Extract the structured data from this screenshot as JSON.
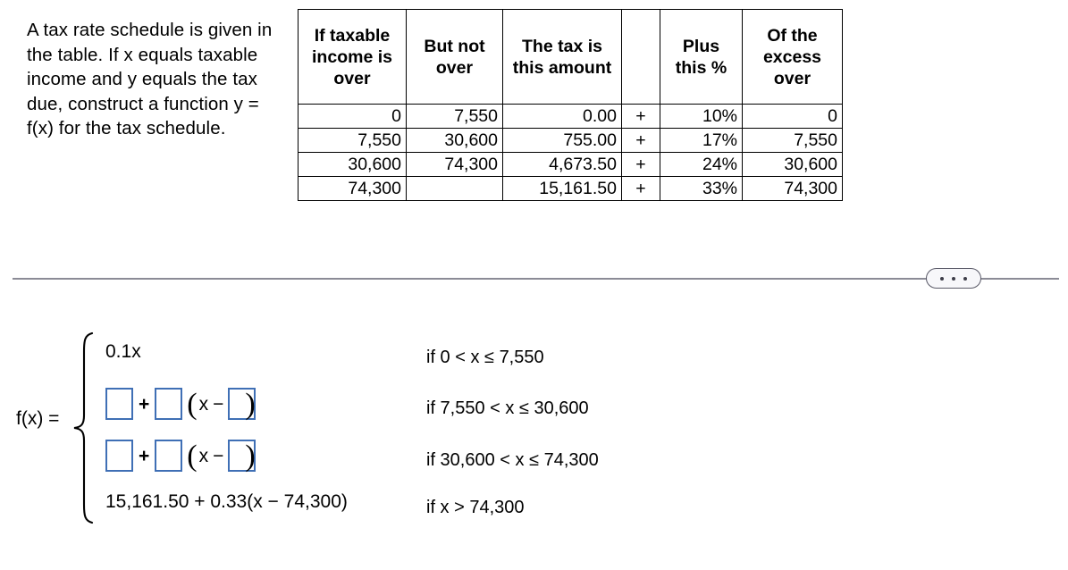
{
  "problem": {
    "statement": "A tax rate schedule is given in the table. If x equals taxable income and y equals the tax due, construct a function y = f(x) for the tax schedule."
  },
  "tax_table": {
    "headers": [
      "If taxable income is over",
      "But not over",
      "The tax is this amount",
      "",
      "Plus this %",
      "Of the excess over"
    ],
    "rows": [
      {
        "over": "0",
        "but_not_over": "7,550",
        "tax_amount": "0.00",
        "plus": "+",
        "percent": "10%",
        "excess_over": "0"
      },
      {
        "over": "7,550",
        "but_not_over": "30,600",
        "tax_amount": "755.00",
        "plus": "+",
        "percent": "17%",
        "excess_over": "7,550"
      },
      {
        "over": "30,600",
        "but_not_over": "74,300",
        "tax_amount": "4,673.50",
        "plus": "+",
        "percent": "24%",
        "excess_over": "30,600"
      },
      {
        "over": "74,300",
        "but_not_over": "",
        "tax_amount": "15,161.50",
        "plus": "+",
        "percent": "33%",
        "excess_over": "74,300"
      }
    ]
  },
  "divider": {
    "more_options_label": "...",
    "line_color": "#8b8b96"
  },
  "piecewise": {
    "fx_label": "f(x) =",
    "box_border_color": "#3f6fb5",
    "rows": [
      {
        "expression": "0.1x",
        "condition": "if 0 < x ≤ 7,550"
      },
      {
        "expression": "",
        "condition": "if 7,550 < x ≤ 30,600"
      },
      {
        "expression": "",
        "condition": "if 30,600 < x ≤ 74,300"
      },
      {
        "expression": "15,161.50 + 0.33(x − 74,300)",
        "condition": "if x > 74,300"
      }
    ],
    "operators": {
      "plus": "+",
      "minus": "−",
      "variable": "x",
      "paren_open": "(",
      "paren_close": ")"
    }
  }
}
